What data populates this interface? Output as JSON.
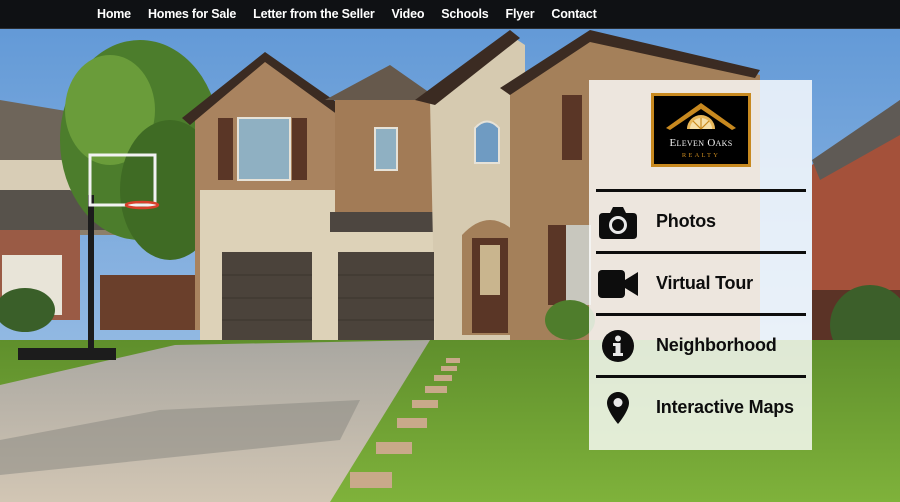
{
  "nav": {
    "items": [
      {
        "label": "Home"
      },
      {
        "label": "Homes for Sale"
      },
      {
        "label": "Letter from the Seller"
      },
      {
        "label": "Video"
      },
      {
        "label": "Schools"
      },
      {
        "label": "Flyer"
      },
      {
        "label": "Contact"
      }
    ]
  },
  "logo": {
    "name": "Eleven Oaks",
    "sub": "REALTY",
    "colors": {
      "gold": "#c8891f",
      "background": "#000000"
    }
  },
  "panel": {
    "items": [
      {
        "label": "Photos",
        "icon": "camera-icon"
      },
      {
        "label": "Virtual Tour",
        "icon": "video-camera-icon"
      },
      {
        "label": "Neighborhood",
        "icon": "info-circle-icon"
      },
      {
        "label": "Interactive Maps",
        "icon": "map-marker-icon"
      }
    ]
  },
  "hero": {
    "description": "Two-story brick and stone house with two-car garage, driveway, lawn with stepping stones, basketball hoop"
  }
}
